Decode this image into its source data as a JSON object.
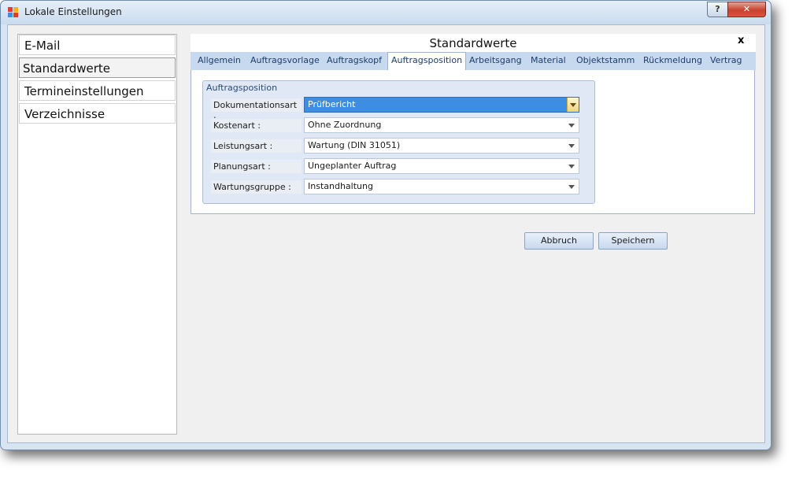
{
  "window": {
    "title": "Lokale Einstellungen",
    "help_label": "?",
    "close_label": "✕"
  },
  "sidebar": {
    "items": [
      {
        "label": "E-Mail"
      },
      {
        "label": "Standardwerte"
      },
      {
        "label": "Termineinstellungen"
      },
      {
        "label": "Verzeichnisse"
      }
    ]
  },
  "panel": {
    "title": "Standardwerte",
    "close_label": "x",
    "tabs": [
      {
        "label": "Allgemein"
      },
      {
        "label": "Auftragsvorlage"
      },
      {
        "label": "Auftragskopf"
      },
      {
        "label": "Auftragsposition"
      },
      {
        "label": "Arbeitsgang"
      },
      {
        "label": "Material"
      },
      {
        "label": "Objektstamm"
      },
      {
        "label": "Rückmeldung"
      },
      {
        "label": "Vertrag"
      }
    ],
    "active_tab": "Auftragsposition",
    "group": {
      "title": "Auftragsposition",
      "fields": [
        {
          "label": "Dokumentationsart :",
          "value": "Prüfbericht"
        },
        {
          "label": "Kostenart :",
          "value": "Ohne Zuordnung"
        },
        {
          "label": "Leistungsart :",
          "value": "Wartung (DIN 31051)"
        },
        {
          "label": "Planungsart :",
          "value": "Ungeplanter Auftrag"
        },
        {
          "label": "Wartungsgruppe :",
          "value": "Instandhaltung"
        }
      ]
    },
    "buttons": {
      "cancel_label": "Abbruch",
      "save_label": "Speichern"
    }
  },
  "colors": {
    "accent": "#3d8ee3",
    "tab_bar": "#c7d9ef",
    "close_button": "#c9412f"
  }
}
